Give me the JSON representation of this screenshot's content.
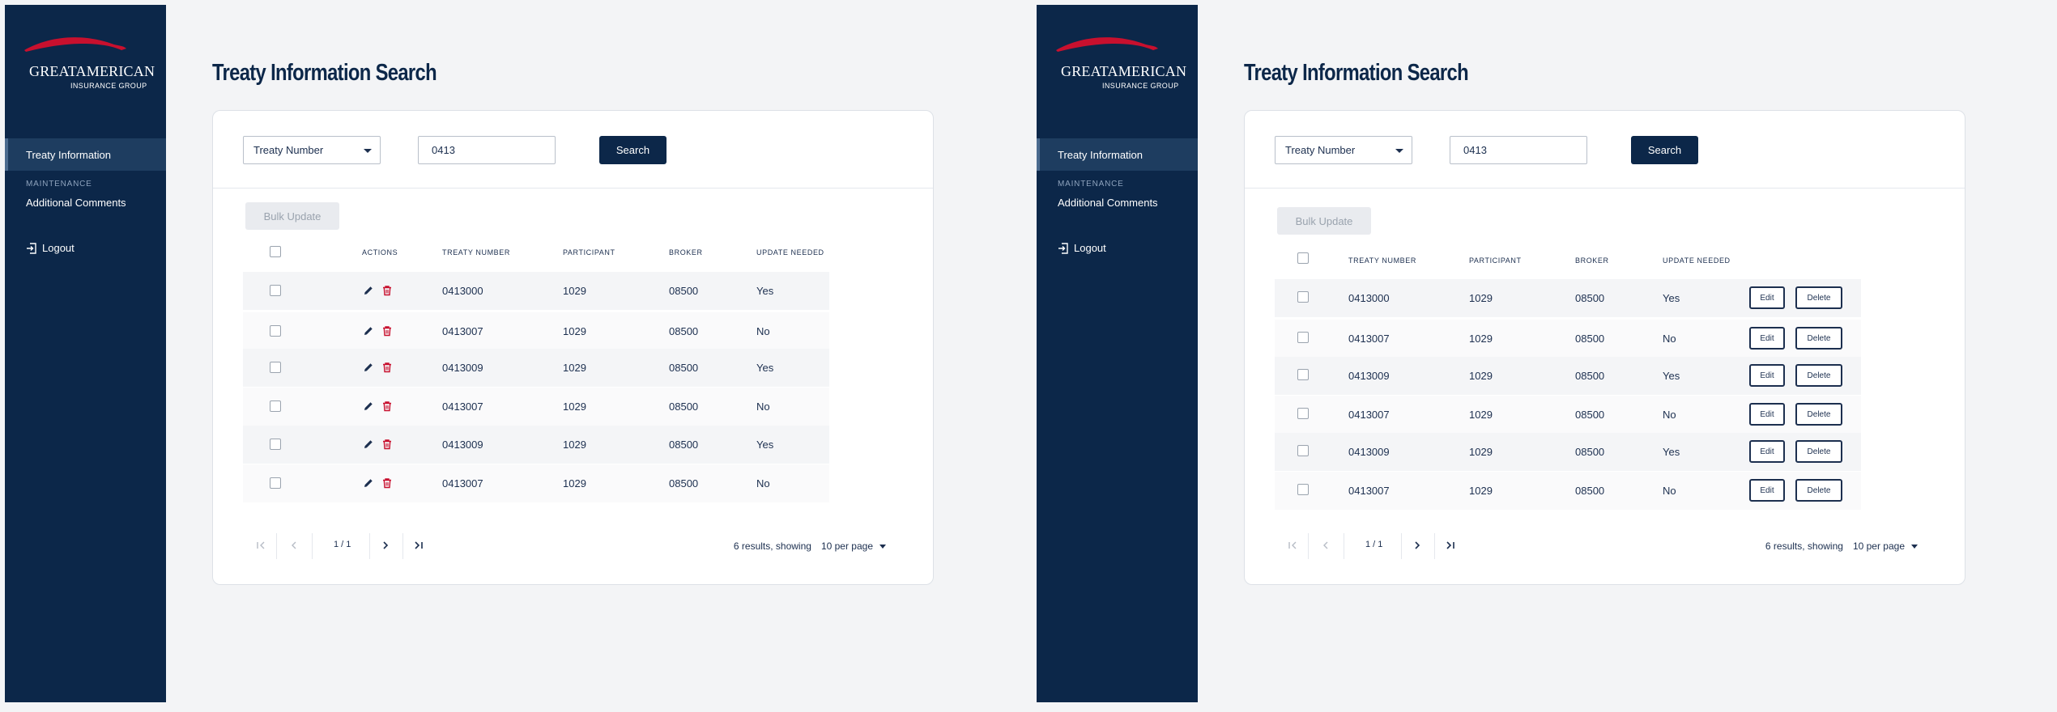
{
  "brand": {
    "logo_main": "GREATAMERICAN",
    "logo_sub": "INSURANCE GROUP",
    "accent": "#c8102e",
    "navy": "#0c2749"
  },
  "sidebar": {
    "active_item": "Treaty Information",
    "section_label": "MAINTENANCE",
    "item_comments": "Additional Comments",
    "logout": "Logout"
  },
  "page": {
    "title": "Treaty Information Search"
  },
  "search": {
    "select_value": "Treaty Number",
    "query": "0413",
    "button": "Search"
  },
  "table": {
    "bulk_update": "Bulk Update",
    "columns": {
      "actions": "ACTIONS",
      "treaty_number": "TREATY NUMBER",
      "participant": "PARTICIPANT",
      "broker": "BROKER",
      "update_needed": "UPDATE NEEDED"
    },
    "rows": [
      {
        "treaty": "0413000",
        "participant": "1029",
        "broker": "08500",
        "update": "Yes"
      },
      {
        "treaty": "0413007",
        "participant": "1029",
        "broker": "08500",
        "update": "No"
      },
      {
        "treaty": "0413009",
        "participant": "1029",
        "broker": "08500",
        "update": "Yes"
      },
      {
        "treaty": "0413007",
        "participant": "1029",
        "broker": "08500",
        "update": "No"
      },
      {
        "treaty": "0413009",
        "participant": "1029",
        "broker": "08500",
        "update": "Yes"
      },
      {
        "treaty": "0413007",
        "participant": "1029",
        "broker": "08500",
        "update": "No"
      }
    ],
    "edit_label": "Edit",
    "delete_label": "Delete"
  },
  "pager": {
    "page": "1 / 1",
    "results": "6 results, showing",
    "per_page": "10 per page"
  }
}
